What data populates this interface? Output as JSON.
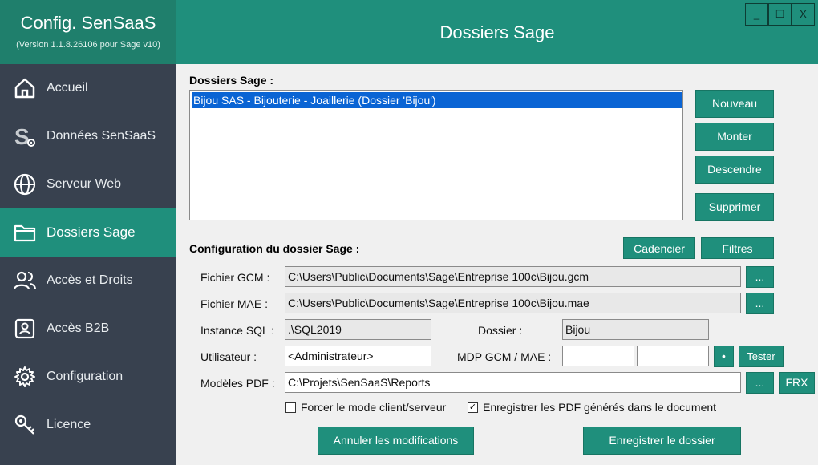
{
  "app": {
    "title": "Config. SenSaaS",
    "version": "(Version 1.1.8.26106 pour Sage v10)"
  },
  "window_controls": {
    "minimize": "_",
    "maximize": "☐",
    "close": "X"
  },
  "header": {
    "title": "Dossiers Sage"
  },
  "nav": [
    {
      "label": "Accueil",
      "icon": "home-icon"
    },
    {
      "label": "Données SenSaaS",
      "icon": "sensaas-s-gear-icon"
    },
    {
      "label": "Serveur Web",
      "icon": "globe-icon"
    },
    {
      "label": "Dossiers Sage",
      "icon": "folder-icon",
      "active": true
    },
    {
      "label": "Accès et Droits",
      "icon": "users-icon"
    },
    {
      "label": "Accès B2B",
      "icon": "id-card-icon"
    },
    {
      "label": "Configuration",
      "icon": "gear-icon"
    },
    {
      "label": "Licence",
      "icon": "key-icon"
    }
  ],
  "dossiers": {
    "label": "Dossiers Sage :",
    "items": [
      "Bijou SAS - Bijouterie - Joaillerie (Dossier 'Bijou')"
    ],
    "buttons": {
      "nouveau": "Nouveau",
      "monter": "Monter",
      "descendre": "Descendre",
      "supprimer": "Supprimer"
    }
  },
  "config": {
    "label": "Configuration du dossier Sage :",
    "cadencier": "Cadencier",
    "filtres": "Filtres",
    "gcm_label": "Fichier GCM :",
    "gcm_value": "C:\\Users\\Public\\Documents\\Sage\\Entreprise 100c\\Bijou.gcm",
    "mae_label": "Fichier MAE :",
    "mae_value": "C:\\Users\\Public\\Documents\\Sage\\Entreprise 100c\\Bijou.mae",
    "browse": "...",
    "sql_label": "Instance SQL :",
    "sql_value": ".\\SQL2019",
    "dossier_label": "Dossier :",
    "dossier_value": "Bijou",
    "user_label": "Utilisateur :",
    "user_value": "<Administrateur>",
    "mdp_label": "MDP GCM / MAE :",
    "mdp_gcm_value": "",
    "mdp_mae_value": "",
    "show_pwd": "•",
    "tester": "Tester",
    "pdf_label": "Modèles PDF :",
    "pdf_value": "C:\\Projets\\SenSaaS\\Reports",
    "frx": "FRX",
    "force_client_server": {
      "label": "Forcer le mode client/serveur",
      "checked": false
    },
    "save_pdf": {
      "label": "Enregistrer les PDF générés dans le document",
      "checked": true
    },
    "cancel": "Annuler les modifications",
    "save": "Enregistrer le dossier"
  },
  "colors": {
    "accent": "#1f8f7c",
    "brand": "#1f7f6c",
    "sidebar": "#38414f",
    "selection": "#0a64d4"
  }
}
